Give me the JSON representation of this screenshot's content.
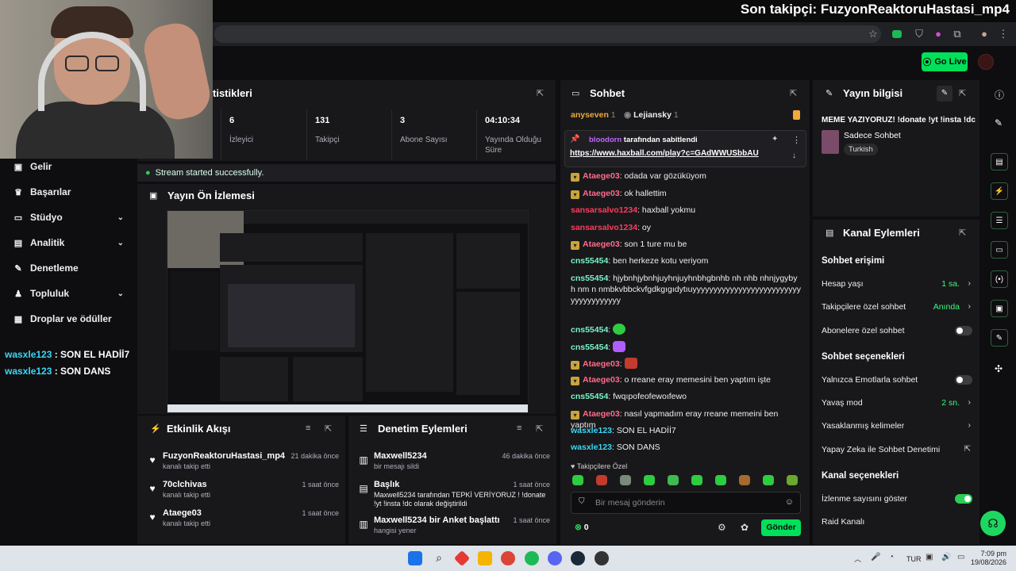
{
  "overlay": {
    "follower": "Son takipçi: FuzyonReaktoruHastasi_mp4"
  },
  "appbar": {
    "go_live": "Go Live"
  },
  "stats": {
    "title": "tistikleri",
    "items": [
      {
        "value": "6",
        "label": "İzleyici"
      },
      {
        "value": "131",
        "label": "Takipçi"
      },
      {
        "value": "3",
        "label": "Abone Sayısı"
      },
      {
        "value": "04:10:34",
        "label": "Yayında Olduğu Süre"
      }
    ]
  },
  "toast": "Stream started successfully.",
  "sidebar": {
    "items": [
      {
        "label": "Gelir",
        "icon": "money-icon"
      },
      {
        "label": "Başarılar",
        "icon": "trophy-icon"
      },
      {
        "label": "Stüdyo",
        "icon": "studio-icon"
      },
      {
        "label": "Analitik",
        "icon": "chart-icon"
      },
      {
        "label": "Denetleme",
        "icon": "wrench-icon"
      },
      {
        "label": "Topluluk",
        "icon": "community-icon"
      },
      {
        "label": "Droplar ve ödüller",
        "icon": "drops-icon"
      }
    ]
  },
  "overlay_chat": [
    {
      "user": "wasxle123",
      "msg": " : SON EL HADİİ7"
    },
    {
      "user": "wasxle123",
      "msg": " : SON DANS"
    }
  ],
  "preview": {
    "title": "Yayın Ön İzlemesi"
  },
  "activity": {
    "title": "Etkinlik Akışı",
    "items": [
      {
        "name": "FuzyonReaktoruHastasi_mp4",
        "sub": "kanalı takip etti",
        "time": "21 dakika önce"
      },
      {
        "name": "70clchivas",
        "sub": "kanalı takip etti",
        "time": "1 saat önce"
      },
      {
        "name": "Ataege03",
        "sub": "kanalı takip etti",
        "time": "1 saat önce"
      }
    ]
  },
  "modact": {
    "title": "Denetim Eylemleri",
    "items": [
      {
        "name": "Maxwell5234",
        "sub": "bir mesajı sildi",
        "time": "46 dakika önce"
      },
      {
        "name": "Başlık",
        "sub": "Maxwell5234 tarafından TEPKİ VERİYORUZ ! !donate !yt !insta !dc olarak değiştirildi",
        "time": "1 saat önce"
      },
      {
        "name": "Maxwell5234 bir Anket başlattı",
        "sub": "hangisi yener",
        "time": "1 saat önce"
      }
    ]
  },
  "chat": {
    "title": "Sohbet",
    "top_users": [
      {
        "name": "anyseven",
        "count": "1"
      },
      {
        "name": "Lejiansky",
        "count": "1"
      }
    ],
    "pinned": {
      "by": "bloodorn",
      "by_suffix": " tarafından sabitlendi",
      "link": "https://www.haxball.com/play?c=GAdWWUSbbAU"
    },
    "messages": [
      {
        "user": "Ataege03",
        "color": "#ff6b8a",
        "badge": true,
        "text": "odada var gözüküyom"
      },
      {
        "user": "Ataege03",
        "color": "#ff6b8a",
        "badge": true,
        "text": "ok hallettim"
      },
      {
        "user": "sansarsalvo1234",
        "color": "#ff3b5c",
        "badge": false,
        "text": "haxball yokmu"
      },
      {
        "user": "sansarsalvo1234",
        "color": "#ff3b5c",
        "badge": false,
        "text": "oy"
      },
      {
        "user": "Ataege03",
        "color": "#ff6b8a",
        "badge": true,
        "text": "son 1 ture mu be"
      },
      {
        "user": "cns55454",
        "color": "#7cf5c6",
        "badge": false,
        "text": "ben herkeze kotu veriyom"
      },
      {
        "user": "cns55454",
        "color": "#7cf5c6",
        "badge": false,
        "text": "hjybnhjybnhjuyhnjuyhnbhgbnhb nh nhb nhnjygybyh nm n nmbkvbbckvfgdkgıgıdytıuyyyyyyyyyyyyyyyyyyyyyyyyyyyyyyyyyyyyyy"
      },
      {
        "user": "cns55454",
        "color": "#7cf5c6",
        "badge": false,
        "text": ""
      },
      {
        "user": "cns55454",
        "color": "#7cf5c6",
        "badge": false,
        "text": ""
      },
      {
        "user": "Ataege03",
        "color": "#ff6b8a",
        "badge": true,
        "text": ""
      },
      {
        "user": "Ataege03",
        "color": "#ff6b8a",
        "badge": true,
        "text": "o rreane eray memesini ben yaptım işte"
      },
      {
        "user": "cns55454",
        "color": "#7cf5c6",
        "badge": false,
        "text": "fwqıpofeofewoıfewo"
      },
      {
        "user": "Ataege03",
        "color": "#ff6b8a",
        "badge": true,
        "text": "nasıl yapmadım eray rreane memeini ben yaptım"
      },
      {
        "user": "wasxle123",
        "color": "#3ad7f7",
        "badge": false,
        "text": "SON EL HADİİ7"
      },
      {
        "user": "wasxle123",
        "color": "#3ad7f7",
        "badge": false,
        "text": "SON DANS"
      }
    ],
    "followers_only": "Takipçilere Özel",
    "input_placeholder": "Bir mesaj gönderin",
    "points": "0",
    "send": "Gönder"
  },
  "info": {
    "title": "Yayın bilgisi",
    "stream_title": "MEME YAZIYORUZ! !donate !yt !insta !dc",
    "category": "Sadece Sohbet",
    "tag": "Turkish"
  },
  "actions": {
    "title": "Kanal Eylemleri",
    "chat_access": "Sohbet erişimi",
    "account_age": {
      "label": "Hesap yaşı",
      "value": "1 sa."
    },
    "followers_chat": {
      "label": "Takipçilere özel sohbet",
      "value": "Anında"
    },
    "subs_chat": {
      "label": "Abonelere özel sohbet"
    },
    "chat_options": "Sohbet seçenekleri",
    "emote_only": {
      "label": "Yalnızca Emotlarla sohbet"
    },
    "slow_mode": {
      "label": "Yavaş mod",
      "value": "2 sn."
    },
    "banned_words": {
      "label": "Yasaklanmış kelimeler"
    },
    "ai_mod": {
      "label": "Yapay Zeka ile Sohbet Denetimi"
    },
    "channel_options": "Kanal seçenekleri",
    "show_viewers": {
      "label": "İzlenme sayısını göster"
    },
    "raid": {
      "label": "Raid Kanalı"
    }
  },
  "taskbar": {
    "lang": "TUR",
    "time": "7:09 pm",
    "date": "19/08/2026"
  }
}
